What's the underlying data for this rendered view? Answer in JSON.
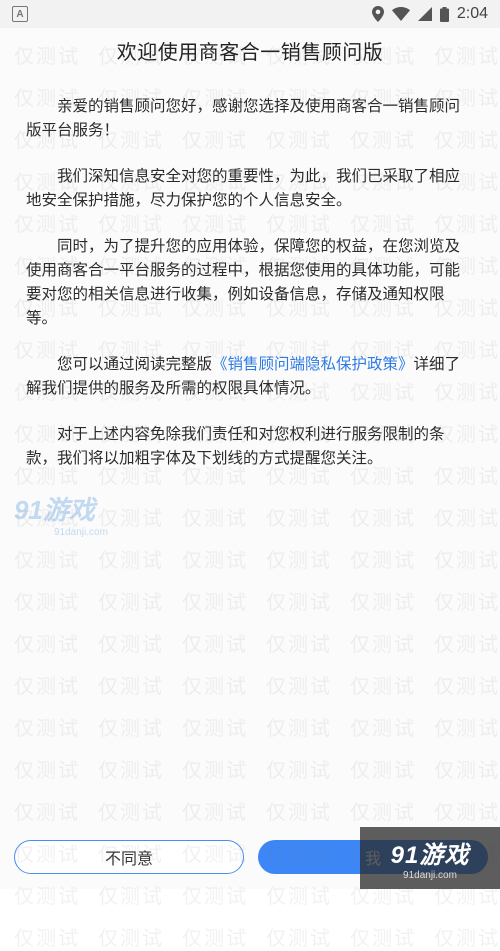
{
  "status_bar": {
    "notification_icon": "A",
    "time": "2:04",
    "icons": [
      "location-icon",
      "wifi-icon",
      "signal-icon",
      "battery-icon"
    ]
  },
  "dialog": {
    "title": "欢迎使用商客合一销售顾问版",
    "paragraphs": {
      "p1": "亲爱的销售顾问您好，感谢您选择及使用商客合一销售顾问版平台服务！",
      "p2": "我们深知信息安全对您的重要性，为此，我们已采取了相应地安全保护措施，尽力保护您的个人信息安全。",
      "p3": "同时，为了提升您的应用体验，保障您的权益，在您浏览及使用商客合一平台服务的过程中，根据您使用的具体功能，可能要对您的相关信息进行收集，例如设备信息，存储及通知权限等。",
      "p4_before": "您可以通过阅读完整版",
      "p4_link": "《销售顾问端隐私保护政策》",
      "p4_after": "详细了解我们提供的服务及所需的权限具体情况。",
      "p5": "对于上述内容免除我们责任和对您权利进行服务限制的条款，我们将以加粗字体及下划线的方式提醒您关注。"
    },
    "buttons": {
      "disagree": "不同意",
      "agree": "我"
    }
  },
  "watermark": {
    "text": "仅测试",
    "logo": "91游戏",
    "logo_sub": "91danji.com"
  },
  "colors": {
    "accent": "#3d86f5",
    "link": "#2f7be6",
    "status_bar_bg": "#f2f2f2"
  }
}
